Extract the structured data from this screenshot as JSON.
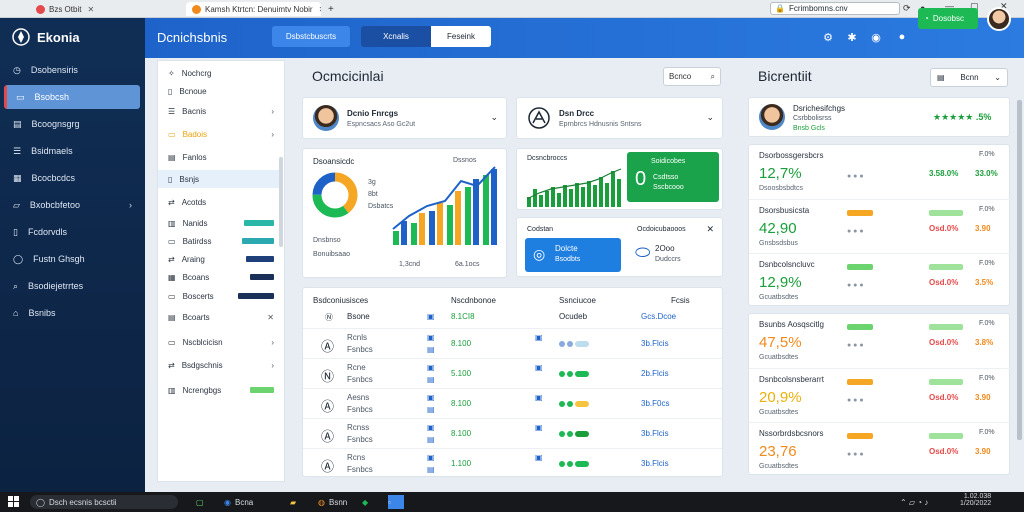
{
  "browser": {
    "tabs": [
      {
        "label": "Bzs Otbit",
        "active": false
      },
      {
        "label": "Kamsh Ktrtcn: Denuimtv Nobir",
        "active": true
      }
    ],
    "new_tab": "+",
    "address": "Fcrimbomns.cnv",
    "minimize": "—",
    "maximize": "▢",
    "close": "✕"
  },
  "app": {
    "brand": "Ekonia",
    "header_title": "Dcnichsbnis",
    "segments": [
      {
        "label": "Dsbstcbuscrts",
        "active": false
      },
      {
        "label": "Xcnalis",
        "active": false
      },
      {
        "label": "Feseink",
        "active": true
      }
    ],
    "header_button": "Dosobsc"
  },
  "sidebar": {
    "items": [
      {
        "label": "Dsobensiris",
        "icon": "clock-icon",
        "active": false
      },
      {
        "label": "Bsobcsh",
        "icon": "folder-icon",
        "active": true
      },
      {
        "label": "Bcoognsgrg",
        "icon": "calendar-icon",
        "active": false
      },
      {
        "label": "Bsidmaels",
        "icon": "list-icon",
        "active": false
      },
      {
        "label": "Bcocbcdcs",
        "icon": "grid-icon",
        "active": false
      },
      {
        "label": "Bxobcbfetoo",
        "icon": "folder-open-icon",
        "active": false,
        "expand": "›"
      },
      {
        "label": "Fcdorvdls",
        "icon": "document-icon",
        "active": false
      },
      {
        "label": "Fustn Ghsgh",
        "icon": "chat-icon",
        "active": false
      },
      {
        "label": "Bsodiejetrrtes",
        "icon": "search-icon",
        "active": false
      },
      {
        "label": "Bsnibs",
        "icon": "home-icon",
        "active": false
      }
    ]
  },
  "subnav": {
    "items": [
      {
        "label": "Nochcrg",
        "icon": "compass-icon"
      },
      {
        "label": "Bcnoue",
        "icon": "document-icon"
      },
      {
        "label": "Bacnis",
        "icon": "list-icon",
        "expand": "›"
      },
      {
        "label": "Badois",
        "icon": "folder-icon",
        "expand": "›",
        "highlight": true
      },
      {
        "label": "Fanlos",
        "icon": "calendar-icon"
      },
      {
        "label": "Bsnjs",
        "icon": "document-icon",
        "active": true
      },
      {
        "label": "Acotds",
        "icon": "share-icon"
      },
      {
        "label": "Nanids",
        "icon": "chart-icon",
        "bar": 0.75,
        "bar_color": "#2bb7a8"
      },
      {
        "label": "Batirdss",
        "icon": "folder-icon",
        "bar": 0.8,
        "bar_color": "#2aa9b0"
      },
      {
        "label": "Araing",
        "icon": "share-icon",
        "bar": 0.7,
        "bar_color": "#1e3f7a"
      },
      {
        "label": "Bcoans",
        "icon": "grid-icon",
        "bar": 0.6,
        "bar_color": "#1a3058"
      },
      {
        "label": "Boscerts",
        "icon": "folder-icon",
        "bar": 0.9,
        "bar_color": "#1a3058"
      },
      {
        "label": "Bcoarts",
        "icon": "calendar-icon",
        "expand": "✕"
      },
      {
        "label": "Nscblcicisn",
        "icon": "folder-icon",
        "expand": "›"
      },
      {
        "label": "Bsdgschnis",
        "icon": "share-icon",
        "expand": "›"
      },
      {
        "label": "Ncrengbgs",
        "icon": "chart-icon",
        "bar": 0.6,
        "bar_color": "#6cd46f"
      }
    ]
  },
  "center": {
    "title": "Ocmcicinlai",
    "search_label": "Bcnco",
    "profile1": {
      "name": "Dcnio Fnrcgs",
      "sub": "Espncsacs Aso Gc2ut"
    },
    "profile2": {
      "name": "Dsn Drcc",
      "sub": "Eprnbrcs Hdnusnis Sntsns"
    },
    "chart1": {
      "title": "Dsoansicdc",
      "title2": "Dssnos",
      "donut_labels": [
        "3g",
        "8bt",
        "Dsbatcs"
      ],
      "legend": [
        "Dnsbnso",
        "Bonuibsaao"
      ],
      "x_labels": [
        "1,3cnd",
        "6a.1ocs"
      ]
    },
    "chart2": {
      "title": "Dcsncbroccs"
    },
    "green_card": {
      "title": "Soidicobes",
      "value": "0",
      "sub1": "Csdtsso",
      "sub2": "Sscbcooo"
    },
    "blue_card": {
      "title": "Codstan",
      "title2": "Bsodbts",
      "right_title": "Ocdoicubaooos",
      "left_value": "Dolcte",
      "right_value": "2Ooo",
      "right_sub": "Dudccrs",
      "close": "✕"
    },
    "table": {
      "headers": [
        "Bsdconiusisces",
        "Nscdnbonoe",
        "Ssnciucoe",
        "Fcsis"
      ],
      "first": {
        "name": "Bsone",
        "v1": "8.1CI8",
        "v2": "Ocudeb",
        "v3": "Gcs.Dcoe"
      },
      "rows": [
        {
          "name": "Rcnls",
          "sub": "Fsnbcs",
          "value": "8.100",
          "num": "3b.Flcis"
        },
        {
          "name": "Rcne",
          "sub": "Fsnbcs",
          "value": "5.100",
          "num": "2b.Flcis"
        },
        {
          "name": "Aesns",
          "sub": "Fsnbcs",
          "value": "8.100",
          "num": "3b.F0cs"
        },
        {
          "name": "Rcnss",
          "sub": "Fsnbcs",
          "value": "8.100",
          "num": "3b.Flcis"
        },
        {
          "name": "Rcns",
          "sub": "Fsnbcs",
          "value": "1.100",
          "num": "3b.Flcis"
        }
      ]
    }
  },
  "right": {
    "title": "Bicrentiit",
    "select_label": "Bcnn",
    "profile": {
      "name": "Dsrichesifchgs",
      "sub": "Csrbbolisrss",
      "sub2": "Bnsb Gcls",
      "rating": "★★★★★ .5%"
    },
    "rows": [
      {
        "label": "Dsorbossgersbcrs",
        "value": "12,7%",
        "color": "#1a9e3c",
        "p1": "3.58.0%",
        "p2": "33.0%",
        "p1c": "#1a9e3c",
        "p2c": "#1a9e3c",
        "sub": "Dsoosbsbdtcs",
        "right": "F.0%"
      },
      {
        "label": "Dsorsbusicsta",
        "value": "42,90",
        "color": "#1a9e3c",
        "p1": "Osd.0%",
        "p2": "3.90",
        "p1c": "#e54a4a",
        "p2c": "#f08a1c",
        "sub": "Gnsbsdsbus",
        "right": "F.0%",
        "tag": "#f5a623"
      },
      {
        "label": "Dsnbcolsncluvc",
        "value": "12,9%",
        "color": "#1a9e3c",
        "p1": "Osd.0%",
        "p2": "3.5%",
        "p1c": "#e54a4a",
        "p2c": "#f08a1c",
        "sub": "Gcuatbsdtes",
        "right": "F.0%",
        "tag": "#6cd46f"
      },
      {
        "label": "Bsunbs Aosqscitlg",
        "value": "47,5%",
        "color": "#f08a1c",
        "p1": "Osd.0%",
        "p2": "3.8%",
        "p1c": "#e54a4a",
        "p2c": "#f08a1c",
        "sub": "Gcuatbsdtes",
        "right": "F.0%",
        "tag": "#6cd46f"
      },
      {
        "label": "Dsnbcolsnsberarrt",
        "value": "20,9%",
        "color": "#e8b20c",
        "p1": "Osd.0%",
        "p2": "3.90",
        "p1c": "#e54a4a",
        "p2c": "#f08a1c",
        "sub": "Gcuatbsdtes",
        "right": "F.0%",
        "tag": "#f5a623"
      },
      {
        "label": "Nssorbrdsbcsnors",
        "value": "23,76",
        "color": "#f08a1c",
        "p1": "Osd.0%",
        "p2": "3.90",
        "p1c": "#e54a4a",
        "p2c": "#f08a1c",
        "sub": "Gcuatbsdtes",
        "right": "F.0%",
        "tag": "#f5a623"
      }
    ]
  },
  "taskbar": {
    "search": "Dsch ecsnis bcsctii",
    "app1": "Bcna",
    "app2": "Bsnn",
    "time": "1.02.038",
    "date": "1/20/2022"
  }
}
